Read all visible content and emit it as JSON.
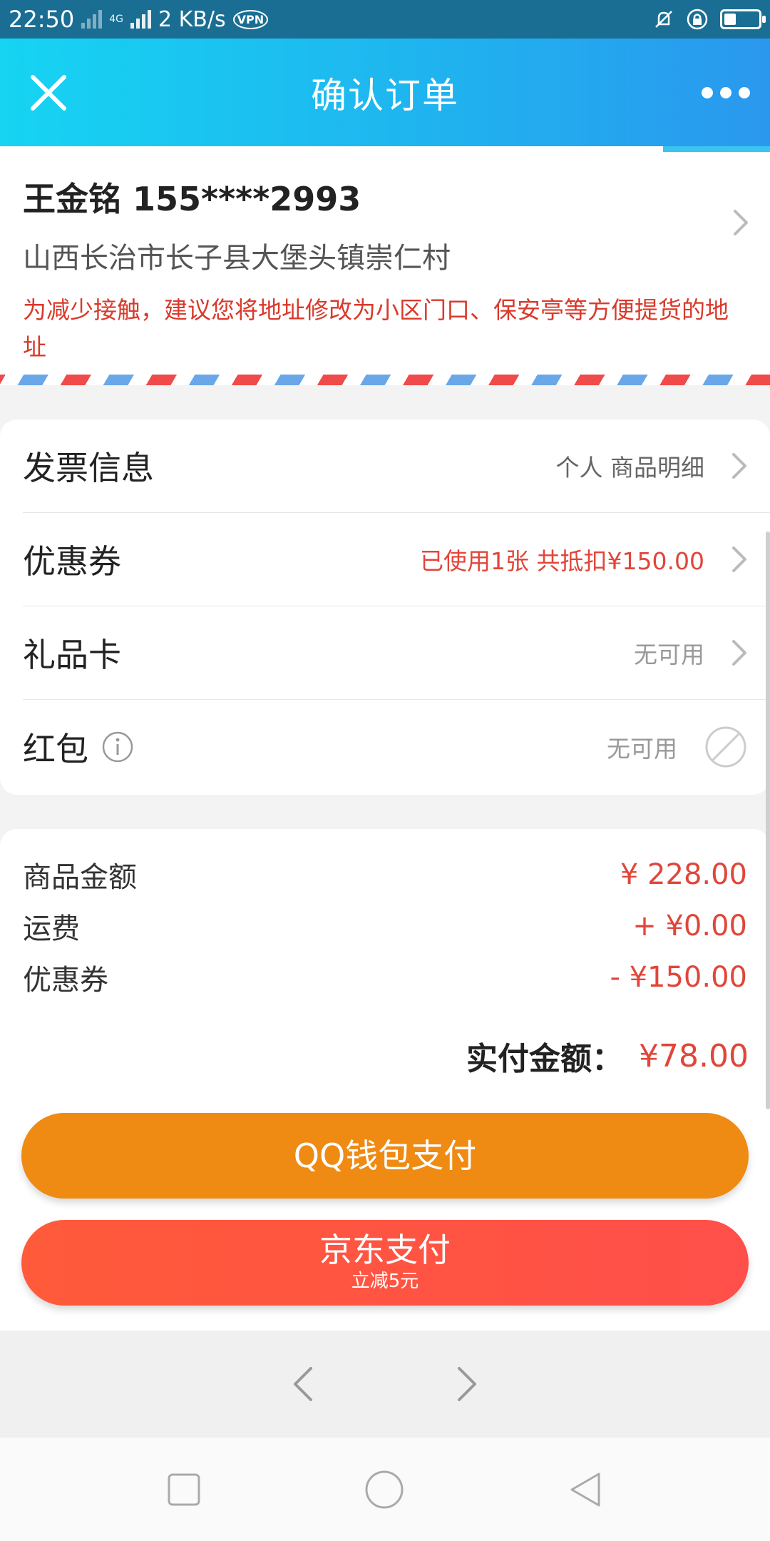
{
  "status_bar": {
    "time": "22:50",
    "network_type": "4G",
    "speed": "2 KB/s",
    "vpn": "VPN"
  },
  "header": {
    "title": "确认订单"
  },
  "address": {
    "name_phone": "王金铭 155****2993",
    "address_line": "山西长治市长子县大堡头镇崇仁村",
    "tip": "为减少接触，建议您将地址修改为小区门口、保安亭等方便提货的地址"
  },
  "options": {
    "invoice": {
      "label": "发票信息",
      "value": "个人 商品明细"
    },
    "coupon": {
      "label": "优惠券",
      "value": "已使用1张 共抵扣¥150.00"
    },
    "giftcard": {
      "label": "礼品卡",
      "value": "无可用"
    },
    "redpacket": {
      "label": "红包",
      "value": "无可用"
    }
  },
  "prices": {
    "goods": {
      "label": "商品金额",
      "value": "¥ 228.00"
    },
    "shipping": {
      "label": "运费",
      "value": "+ ¥0.00"
    },
    "coupon": {
      "label": "优惠券",
      "value": "- ¥150.00"
    },
    "total_label": "实付金额：",
    "total_value": "¥78.00"
  },
  "pay": {
    "qq_label": "QQ钱包支付",
    "jd_label": "京东支付",
    "jd_sub": "立减5元"
  },
  "colors": {
    "accent_red": "#e0463a",
    "qq_orange": "#ef8a12",
    "jd_red": "#ff5047",
    "header_blue": "#1fb4ef"
  }
}
